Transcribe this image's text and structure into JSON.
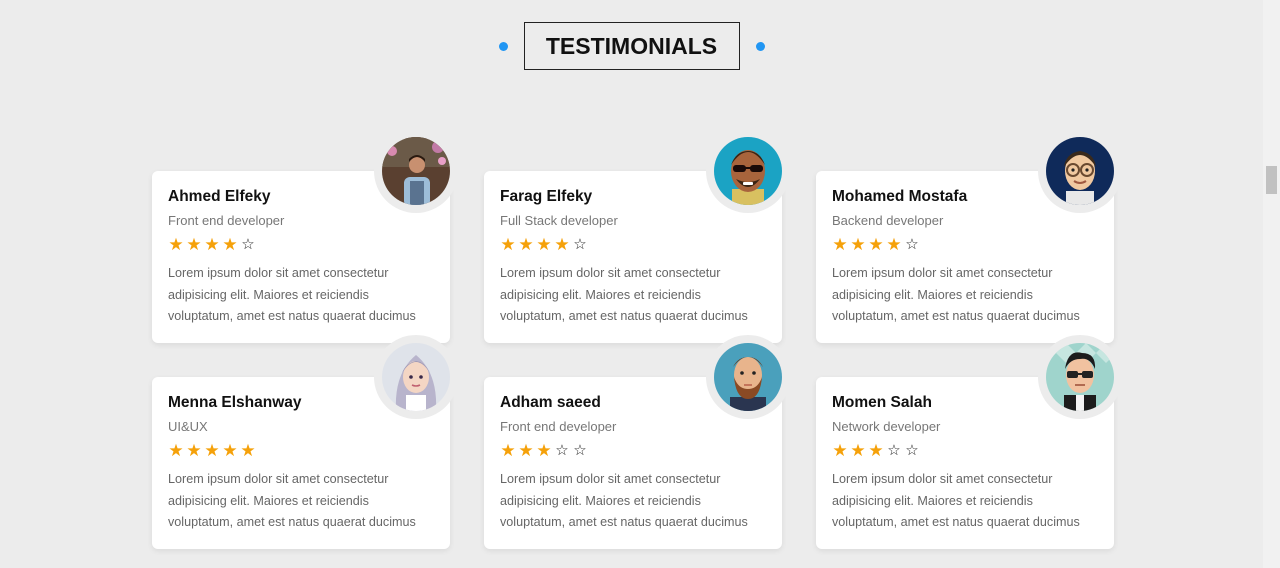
{
  "section": {
    "title": "TESTIMONIALS",
    "accent": "#2196f3",
    "star_color": "#f5a10a"
  },
  "testimonials": [
    {
      "name": "Ahmed Elfeky",
      "role": "Front end developer",
      "rating": 4,
      "avatar": "man-photo-avatar",
      "lines": [
        "Lorem ipsum dolor sit amet consectetur",
        "adipisicing elit. Maiores et reiciendis",
        "voluptatum, amet est natus quaerat ducimus"
      ]
    },
    {
      "name": "Farag Elfeky",
      "role": "Full Stack developer",
      "rating": 4,
      "avatar": "cartoon-sunglasses-avatar",
      "lines": [
        "Lorem ipsum dolor sit amet consectetur",
        "adipisicing elit. Maiores et reiciendis",
        "voluptatum, amet est natus quaerat ducimus"
      ]
    },
    {
      "name": "Mohamed Mostafa",
      "role": "Backend developer",
      "rating": 4,
      "avatar": "cartoon-glasses-avatar",
      "lines": [
        "Lorem ipsum dolor sit amet consectetur",
        "adipisicing elit. Maiores et reiciendis",
        "voluptatum, amet est natus quaerat ducimus"
      ]
    },
    {
      "name": "Menna Elshanway",
      "role": "UI&UX",
      "rating": 5,
      "avatar": "cartoon-woman-avatar",
      "lines": [
        "Lorem ipsum dolor sit amet consectetur",
        "adipisicing elit. Maiores et reiciendis",
        "voluptatum, amet est natus quaerat ducimus"
      ]
    },
    {
      "name": "Adham saeed",
      "role": "Front end developer",
      "rating": 3,
      "avatar": "cartoon-beard-avatar",
      "lines": [
        "Lorem ipsum dolor sit amet consectetur",
        "adipisicing elit. Maiores et reiciendis",
        "voluptatum, amet est natus quaerat ducimus"
      ]
    },
    {
      "name": "Momen Salah",
      "role": "Network developer",
      "rating": 3,
      "avatar": "cartoon-sunglasses-man-avatar",
      "lines": [
        "Lorem ipsum dolor sit amet consectetur",
        "adipisicing elit. Maiores et reiciendis",
        "voluptatum, amet est natus quaerat ducimus"
      ]
    }
  ]
}
